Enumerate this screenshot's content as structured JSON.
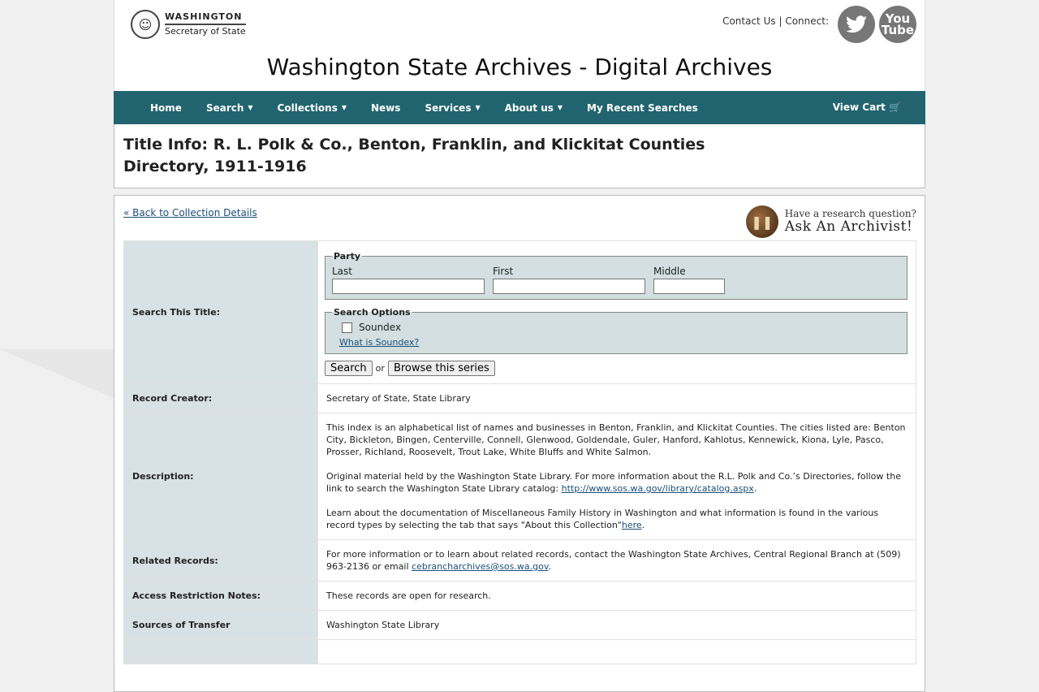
{
  "header": {
    "logo_top": "WASHINGTON",
    "logo_bottom": "Secretary of State",
    "contact": "Contact Us",
    "separator": "|",
    "connect": "Connect:",
    "youtube": "You Tube",
    "site_title": "Washington State Archives - Digital Archives"
  },
  "nav": {
    "items": [
      {
        "label": "Home",
        "dropdown": false
      },
      {
        "label": "Search",
        "dropdown": true
      },
      {
        "label": "Collections",
        "dropdown": true
      },
      {
        "label": "News",
        "dropdown": false
      },
      {
        "label": "Services",
        "dropdown": true
      },
      {
        "label": "About us",
        "dropdown": true
      },
      {
        "label": "My Recent Searches",
        "dropdown": false
      }
    ],
    "cart": "View Cart 🛒"
  },
  "title": "Title Info: R. L. Polk & Co., Benton, Franklin, and Klickitat Counties Directory, 1911-1916",
  "back_link": "« Back to Collection Details",
  "ask": {
    "line1": "Have a research question?",
    "line2": "Ask An Archivist!"
  },
  "search": {
    "label": "Search This Title:",
    "party_legend": "Party",
    "last_label": "Last",
    "first_label": "First",
    "middle_label": "Middle",
    "last_value": "",
    "first_value": "",
    "middle_value": "",
    "options_legend": "Search Options",
    "soundex_label": "Soundex",
    "soundex_link": "What is Soundex?",
    "search_button": "Search",
    "or": "or",
    "browse_button": "Browse this series"
  },
  "rows": {
    "creator_label": "Record Creator:",
    "creator_value": "Secretary of State, State Library",
    "description_label": "Description:",
    "desc_p1": "This index is an alphabetical list of names and businesses in Benton, Franklin, and Klickitat Counties. The cities listed are: Benton City, Bickleton, Bingen, Centerville, Connell, Glenwood, Goldendale, Guler, Hanford, Kahlotus, Kennewick, Kiona, Lyle, Pasco, Prosser, Richland, Roosevelt, Trout Lake, White Bluffs and White Salmon.",
    "desc_p2_text": "Original material held by the Washington State Library. For more information about the R.L. Polk and Co.’s Directories, follow the link to search the Washington State Library catalog: ",
    "desc_p2_link": "http://www.sos.wa.gov/library/catalog.aspx",
    "desc_p2_end": ".",
    "desc_p3_text": "Learn about the documentation of Miscellaneous Family History in Washington and what information is found in the various record types by selecting the tab that says \"About this Collection\"",
    "desc_p3_link": "here",
    "desc_p3_end": ".",
    "related_label": "Related Records:",
    "related_text": "For more information or to learn about related records, contact the Washington State Archives, Central Regional Branch at (509) 963-2136 or email ",
    "related_link": "cebrancharchives@sos.wa.gov",
    "related_end": ".",
    "access_label": "Access Restriction Notes:",
    "access_value": "These records are open for research.",
    "sources_label": "Sources of Transfer",
    "sources_value": "Washington State Library"
  }
}
